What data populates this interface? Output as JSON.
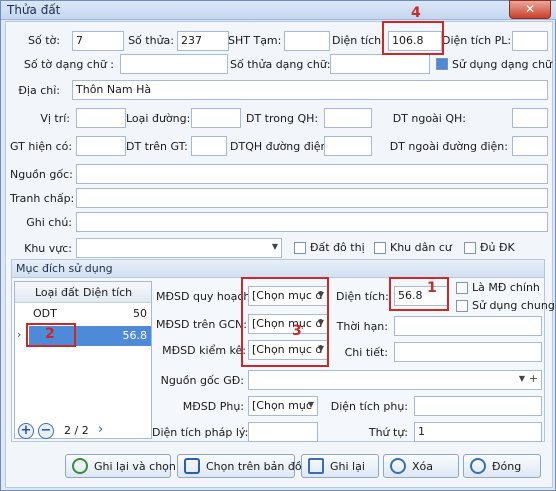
{
  "window": {
    "title": "Thửa đất",
    "close_label": "✕"
  },
  "fields": {
    "so_to": {
      "label": "Số tờ:",
      "value": "7"
    },
    "so_thua": {
      "label": "Số thửa:",
      "value": "237"
    },
    "sht_tam": {
      "label": "SHT Tạm:",
      "value": ""
    },
    "dien_tich": {
      "label": "Diện tích:",
      "value": "106.8"
    },
    "dien_tich_pl": {
      "label": "Diện tích PL:",
      "value": ""
    },
    "so_to_dang_chu": {
      "label": "Số tờ dạng chữ :",
      "value": ""
    },
    "so_thua_dang_chu": {
      "label": "Số thửa dạng chữ:",
      "value": ""
    },
    "su_dung_dang_chu": {
      "label": "Sử dụng dạng chữ",
      "checked": true
    },
    "dia_chi": {
      "label": "Địa chỉ:",
      "value": "Thôn Nam Hà"
    },
    "vi_tri": {
      "label": "Vị trí:",
      "value": ""
    },
    "loai_duong": {
      "label": "Loại đường:",
      "value": ""
    },
    "dt_trong_qh": {
      "label": "DT trong QH:",
      "value": ""
    },
    "dt_ngoai_qh": {
      "label": "DT ngoài QH:",
      "value": ""
    },
    "gt_hien_co": {
      "label": "GT hiện có:",
      "value": ""
    },
    "dt_tren_gt": {
      "label": "DT trên GT:",
      "value": ""
    },
    "dtqh_duong_dien": {
      "label": "DTQH đường điện:",
      "value": ""
    },
    "dt_ngoai_duong_dien": {
      "label": "DT ngoài đường điện:",
      "value": ""
    },
    "nguon_goc": {
      "label": "Nguồn gốc:",
      "value": ""
    },
    "tranh_chap": {
      "label": "Tranh chấp:",
      "value": ""
    },
    "ghi_chu": {
      "label": "Ghi chú:",
      "value": ""
    },
    "khu_vuc": {
      "label": "Khu vực:",
      "value": ""
    },
    "dat_do_thi": {
      "label": "Đất đô thị"
    },
    "khu_dan_cu": {
      "label": "Khu dân cư"
    },
    "du_dk": {
      "label": "Đủ ĐK"
    }
  },
  "muc_dich": {
    "title": "Mục đích sử dụng",
    "columns": [
      "Loại đất",
      "Diện tích"
    ],
    "rows": [
      {
        "loai_dat": "ODT",
        "dien_tich": "50"
      },
      {
        "loai_dat": "",
        "dien_tich": "56.8"
      }
    ],
    "pager": "2 / 2",
    "mdsd_quy_hoach": {
      "label": "MĐSD quy hoạch:",
      "value": "[Chọn mục đ"
    },
    "mdsd_tren_gcn": {
      "label": "MĐSD trên GCN:",
      "value": "[Chọn mục đ"
    },
    "mdsd_kiem_ke": {
      "label": "MĐSD kiểm kê:",
      "value": "[Chọn mục đ"
    },
    "dien_tich": {
      "label": "Diện tích:",
      "value": "56.8"
    },
    "la_md_chinh": {
      "label": "Là MĐ chính"
    },
    "su_dung_chung": {
      "label": "Sử dụng chung"
    },
    "thoi_han": {
      "label": "Thời hạn:",
      "value": ""
    },
    "chi_tiet": {
      "label": "Chi tiết:",
      "value": ""
    },
    "nguon_goc_gd": {
      "label": "Nguồn gốc GĐ:",
      "value": ""
    },
    "mdsd_phu": {
      "label": "MĐSD Phụ:",
      "value": "[Chọn mục"
    },
    "dien_tich_phu": {
      "label": "Diện tích phụ:",
      "value": ""
    },
    "dien_tich_phap_ly": {
      "label": "Diện tích pháp lý:",
      "value": ""
    },
    "thu_tu": {
      "label": "Thứ tự:",
      "value": "1"
    }
  },
  "buttons": {
    "ghi_lai_va_chon": "Ghi lại và chọn",
    "chon_tren_ban_do": "Chọn trên bản đồ",
    "ghi_lai": "Ghi lại",
    "xoa": "Xóa",
    "dong": "Đóng"
  },
  "annotations": {
    "a1": "1",
    "a2": "2",
    "a3": "3",
    "a4": "4"
  }
}
